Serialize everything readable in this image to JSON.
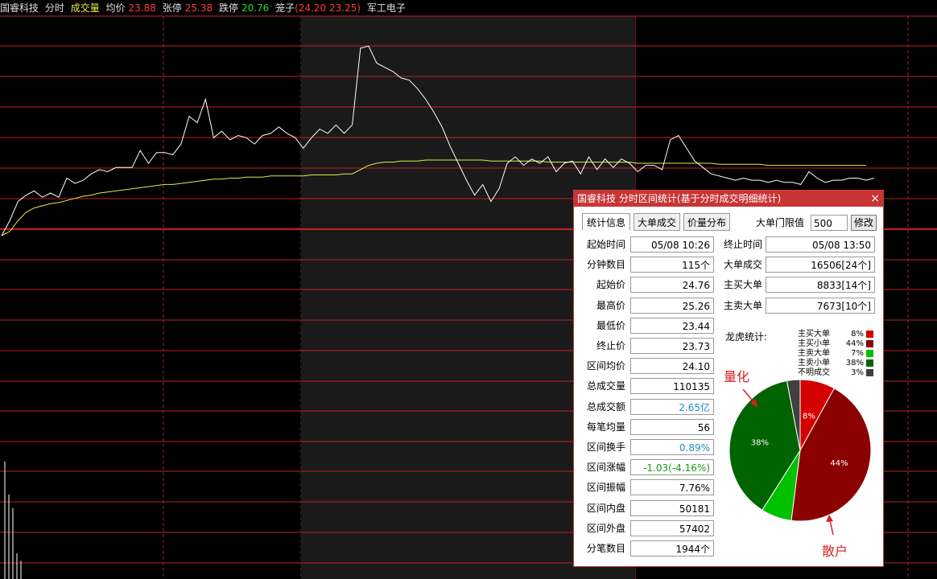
{
  "topbar": {
    "stock": "国睿科技",
    "mode": "分时",
    "vol_label": "成交量",
    "avg_label": "均价",
    "avg_value": "23.88",
    "up_label": "张停",
    "up_value": "25.38",
    "down_label": "跌停",
    "down_value": "20.76",
    "cage_label": "笼子",
    "cage_value": "(24.20 23.25)",
    "sector": "军工电子"
  },
  "chart_data": {
    "type": "line",
    "price_series_name": "",
    "avg_series_name": "",
    "price": [
      23.44,
      23.58,
      23.76,
      23.82,
      23.86,
      23.8,
      23.84,
      23.8,
      23.98,
      23.93,
      23.96,
      24.02,
      24.06,
      24.04,
      24.08,
      24.08,
      24.08,
      24.24,
      24.12,
      24.22,
      24.22,
      24.2,
      24.3,
      24.56,
      24.5,
      24.72,
      24.36,
      24.42,
      24.34,
      24.38,
      24.36,
      24.3,
      24.38,
      24.4,
      24.46,
      24.4,
      24.36,
      24.26,
      24.36,
      24.44,
      24.4,
      24.48,
      24.4,
      24.48,
      25.2,
      25.22,
      25.06,
      25.02,
      24.98,
      24.92,
      24.9,
      24.82,
      24.72,
      24.6,
      24.46,
      24.28,
      24.12,
      23.96,
      23.82,
      23.92,
      23.76,
      23.88,
      24.12,
      24.18,
      24.1,
      24.16,
      24.12,
      24.18,
      24.04,
      24.12,
      24.14,
      24.02,
      24.18,
      24.06,
      24.16,
      24.08,
      24.16,
      24.12,
      24.04,
      24.1,
      24.1,
      24.06,
      24.34,
      24.38,
      24.26,
      24.14,
      24.08,
      24.02,
      24.0,
      23.98,
      23.96,
      23.98,
      23.96,
      23.96,
      23.94,
      23.96,
      23.94,
      23.94,
      23.92,
      24.04,
      23.98,
      23.94,
      23.96,
      23.96,
      23.98,
      23.98,
      23.96,
      23.98
    ],
    "avg": [
      23.44,
      23.48,
      23.58,
      23.66,
      23.7,
      23.72,
      23.74,
      23.75,
      23.77,
      23.79,
      23.81,
      23.82,
      23.84,
      23.85,
      23.86,
      23.87,
      23.88,
      23.89,
      23.9,
      23.91,
      23.92,
      23.92,
      23.93,
      23.94,
      23.95,
      23.96,
      23.97,
      23.97,
      23.98,
      23.98,
      23.99,
      23.99,
      23.99,
      24.0,
      24.0,
      24.0,
      24.0,
      24.0,
      24.01,
      24.01,
      24.01,
      24.01,
      24.02,
      24.02,
      24.06,
      24.1,
      24.12,
      24.13,
      24.13,
      24.14,
      24.14,
      24.14,
      24.15,
      24.15,
      24.15,
      24.15,
      24.15,
      24.15,
      24.15,
      24.15,
      24.14,
      24.14,
      24.14,
      24.14,
      24.14,
      24.14,
      24.14,
      24.13,
      24.13,
      24.13,
      24.13,
      24.13,
      24.13,
      24.13,
      24.13,
      24.13,
      24.13,
      24.13,
      24.12,
      24.12,
      24.12,
      24.12,
      24.12,
      24.12,
      24.12,
      24.12,
      24.12,
      24.12,
      24.11,
      24.11,
      24.11,
      24.11,
      24.11,
      24.11,
      24.1,
      24.1,
      24.1,
      24.1,
      24.1,
      24.1,
      24.1,
      24.1,
      24.1,
      24.1,
      24.1,
      24.1,
      24.1
    ],
    "volume_bars": [
      0.78,
      0.56,
      0.47,
      0.17,
      0.12
    ],
    "grid": true
  },
  "dialog": {
    "title": "国睿科技 分时区间统计(基于分时成交明细统计)",
    "close_symbol": "×",
    "tabs": [
      "统计信息",
      "大单成交",
      "价量分布"
    ],
    "threshold_label": "大单门限值",
    "threshold_value": "500",
    "modify_label": "修改",
    "left_stats": [
      {
        "label": "起始时间",
        "value": "05/08 10:26"
      },
      {
        "label": "分钟数目",
        "value": "115个"
      },
      {
        "label": "起始价",
        "value": "24.76"
      },
      {
        "label": "最高价",
        "value": "25.26"
      },
      {
        "label": "最低价",
        "value": "23.44"
      },
      {
        "label": "终止价",
        "value": "23.73"
      },
      {
        "label": "区间均价",
        "value": "24.10"
      },
      {
        "label": "总成交量",
        "value": "110135"
      },
      {
        "label": "总成交额",
        "value": "2.65亿"
      },
      {
        "label": "每笔均量",
        "value": "56"
      },
      {
        "label": "区间换手",
        "value": "0.89%"
      },
      {
        "label": "区间涨幅",
        "value": "-1.03(-4.16%)"
      },
      {
        "label": "区间振幅",
        "value": "7.76%"
      },
      {
        "label": "区间内盘",
        "value": "50181"
      },
      {
        "label": "区间外盘",
        "value": "57402"
      },
      {
        "label": "分笔数目",
        "value": "1944个"
      }
    ],
    "right_stats": [
      {
        "label": "终止时间",
        "value": "05/08 13:50"
      },
      {
        "label": "大单成交",
        "value": "16506[24个]"
      },
      {
        "label": "主买大单",
        "value": "8833[14个]"
      },
      {
        "label": "主卖大单",
        "value": "7673[10个]"
      }
    ],
    "longhu_label": "龙虎统计:",
    "pie": [
      {
        "name": "主买大单",
        "pct": "8%",
        "value": 8,
        "color": "#d40000"
      },
      {
        "name": "主买小单",
        "pct": "44%",
        "value": 44,
        "color": "#8b0000"
      },
      {
        "name": "主卖大单",
        "pct": "7%",
        "value": 7,
        "color": "#00c000"
      },
      {
        "name": "主卖小单",
        "pct": "38%",
        "value": 38,
        "color": "#006400"
      },
      {
        "name": "不明成交",
        "pct": "3%",
        "value": 3,
        "color": "#404040"
      }
    ],
    "annotation_quant": "量化",
    "annotation_retail": "散户"
  },
  "colors": {
    "grid_red": "#c42020",
    "price_line": "#ffffff",
    "avg_line": "#e8e84a",
    "volume": "#ffffff",
    "blue_value": "#1a8fbf",
    "green_value": "#1a9a1a"
  }
}
